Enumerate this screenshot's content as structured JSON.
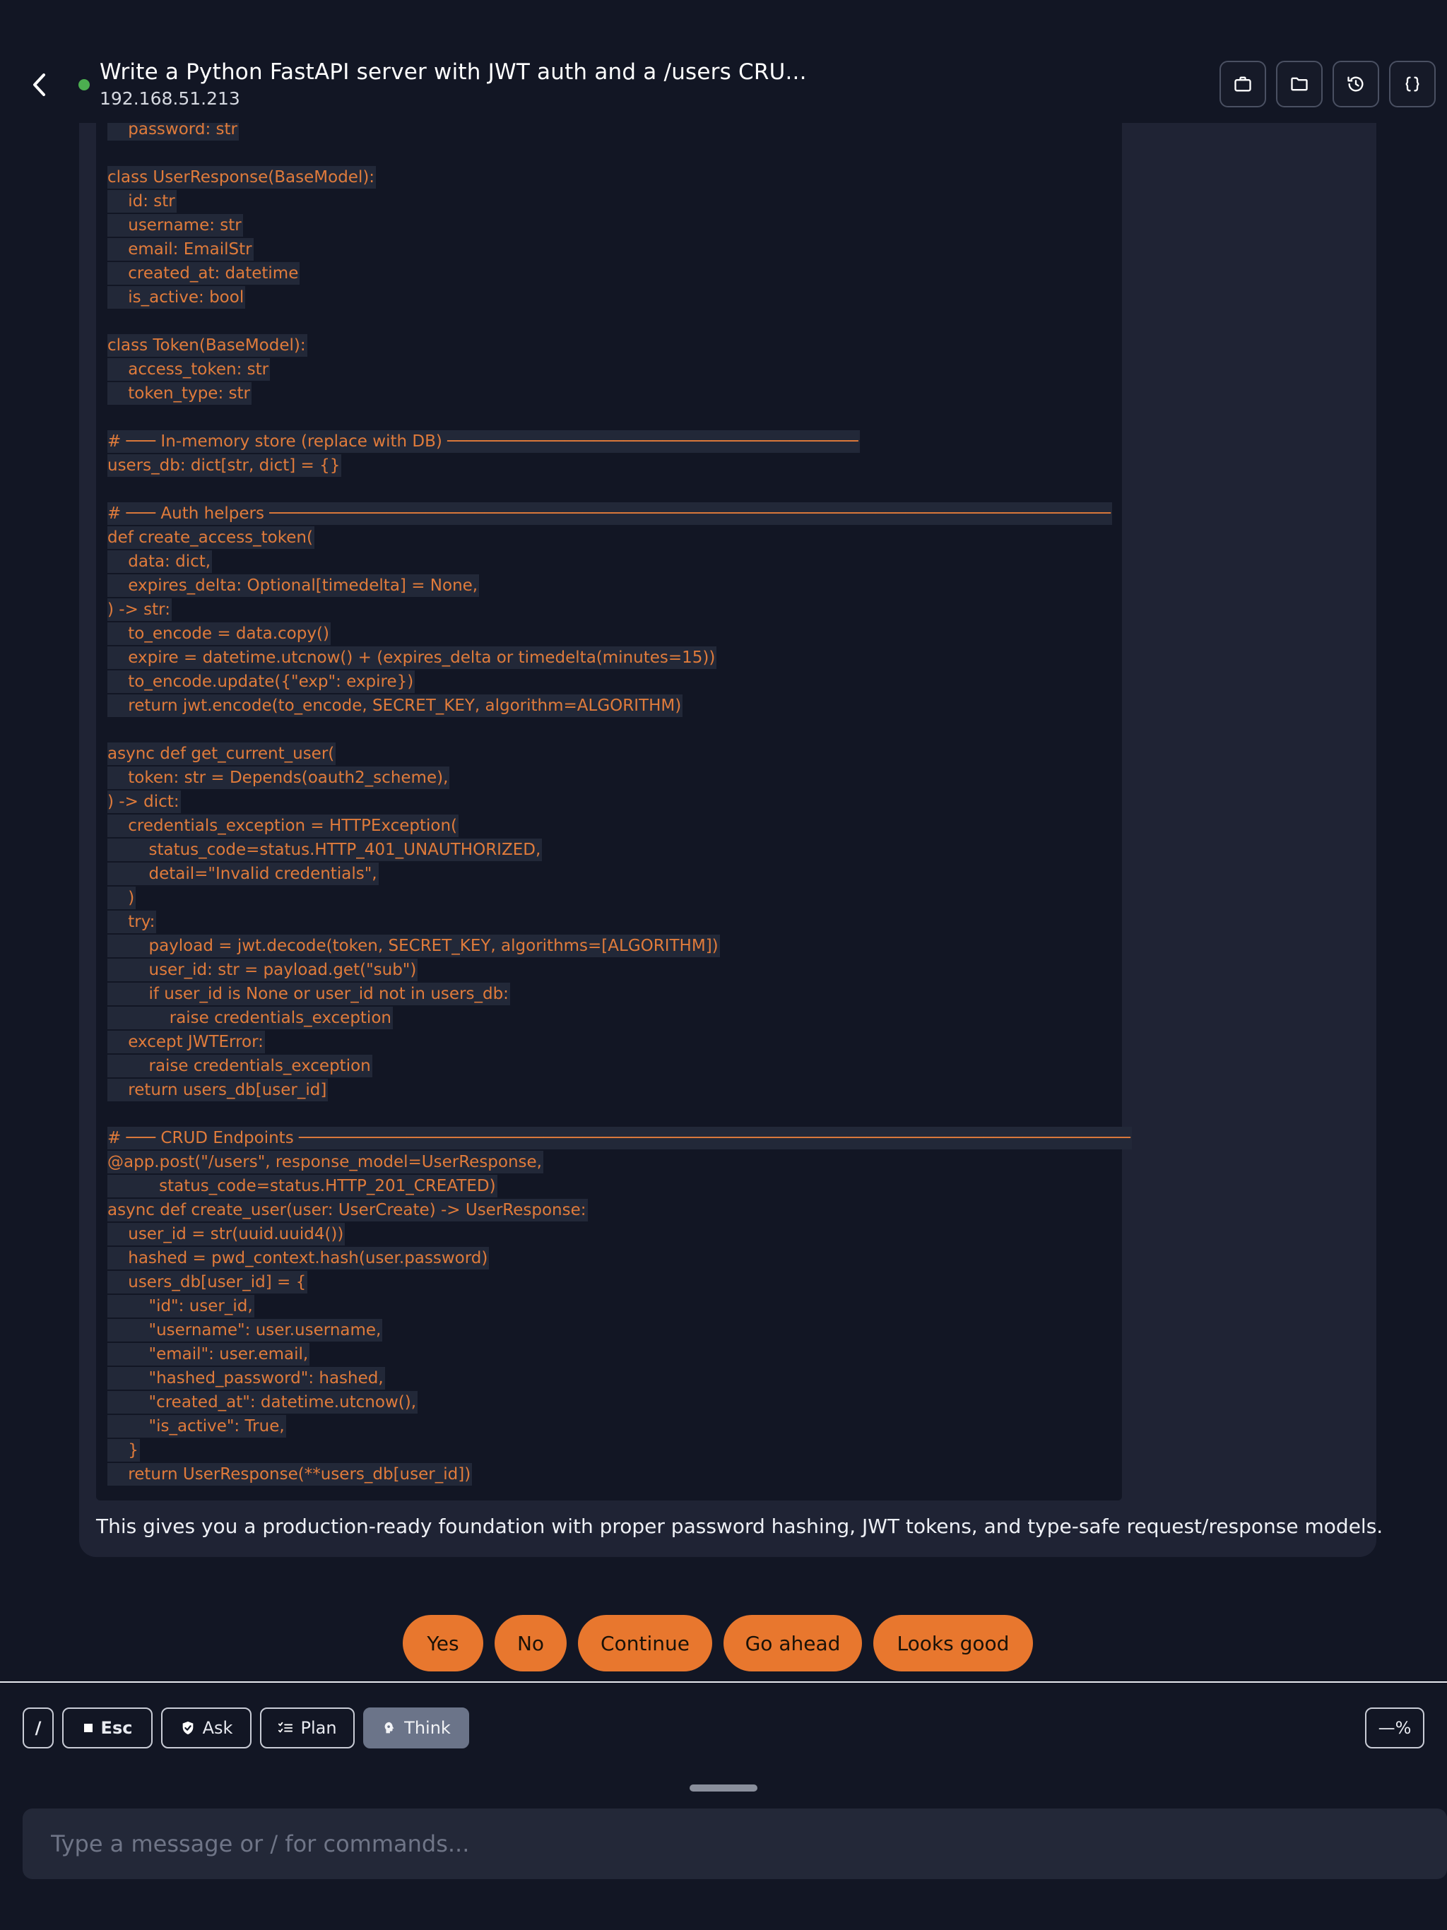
{
  "header": {
    "title": "Write a Python FastAPI server with JWT auth and a /users CRU...",
    "subtitle": "192.168.51.213",
    "status_color": "#4caf50",
    "buttons": [
      "briefcase-icon",
      "folder-icon",
      "history-icon",
      "braces-icon"
    ]
  },
  "code": {
    "lines": [
      "    password: str",
      "",
      "class UserResponse(BaseModel):",
      "    id: str",
      "    username: str",
      "    email: EmailStr",
      "    created_at: datetime",
      "    is_active: bool",
      "",
      "class Token(BaseModel):",
      "    access_token: str",
      "    token_type: str",
      "",
      "# ─── In-memory store (replace with DB) ──────────────────────────────────────────",
      "users_db: dict[str, dict] = {}",
      "",
      "# ─── Auth helpers ──────────────────────────────────────────────────────────────────────────────────────",
      "def create_access_token(",
      "    data: dict,",
      "    expires_delta: Optional[timedelta] = None,",
      ") -> str:",
      "    to_encode = data.copy()",
      "    expire = datetime.utcnow() + (expires_delta or timedelta(minutes=15))",
      "    to_encode.update({\"exp\": expire})",
      "    return jwt.encode(to_encode, SECRET_KEY, algorithm=ALGORITHM)",
      "",
      "async def get_current_user(",
      "    token: str = Depends(oauth2_scheme),",
      ") -> dict:",
      "    credentials_exception = HTTPException(",
      "        status_code=status.HTTP_401_UNAUTHORIZED,",
      "        detail=\"Invalid credentials\",",
      "    )",
      "    try:",
      "        payload = jwt.decode(token, SECRET_KEY, algorithms=[ALGORITHM])",
      "        user_id: str = payload.get(\"sub\")",
      "        if user_id is None or user_id not in users_db:",
      "            raise credentials_exception",
      "    except JWTError:",
      "        raise credentials_exception",
      "    return users_db[user_id]",
      "",
      "# ─── CRUD Endpoints ─────────────────────────────────────────────────────────────────────────────────────",
      "@app.post(\"/users\", response_model=UserResponse,",
      "          status_code=status.HTTP_201_CREATED)",
      "async def create_user(user: UserCreate) -> UserResponse:",
      "    user_id = str(uuid.uuid4())",
      "    hashed = pwd_context.hash(user.password)",
      "    users_db[user_id] = {",
      "        \"id\": user_id,",
      "        \"username\": user.username,",
      "        \"email\": user.email,",
      "        \"hashed_password\": hashed,",
      "        \"created_at\": datetime.utcnow(),",
      "        \"is_active\": True,",
      "    }",
      "    return UserResponse(**users_db[user_id])"
    ],
    "text_color": "#e07b3b"
  },
  "summary": "This gives you a production-ready foundation with proper password hashing, JWT tokens, and type-safe request/response models.",
  "quick_replies": {
    "yes": "Yes",
    "no": "No",
    "continue": "Continue",
    "go_ahead": "Go ahead",
    "looks_good": "Looks good",
    "color": "#e8772e"
  },
  "toolbar": {
    "slash": "/",
    "esc": "Esc",
    "ask": "Ask",
    "plan": "Plan",
    "think": "Think",
    "percent": "—%"
  },
  "composer": {
    "placeholder": "Type a message or / for commands..."
  }
}
